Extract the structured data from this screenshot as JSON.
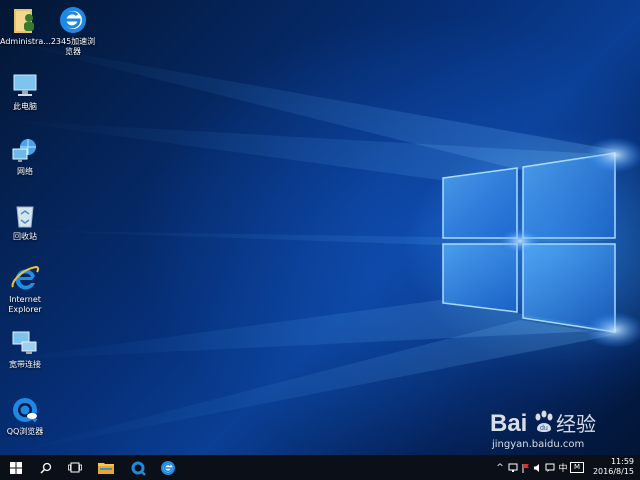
{
  "desktop": {
    "icons": [
      {
        "label": "Administra..."
      },
      {
        "label": "2345加速浏\n览器"
      },
      {
        "label": "此电脑"
      },
      {
        "label": "网络"
      },
      {
        "label": "回收站"
      },
      {
        "label": "Internet\nExplorer"
      },
      {
        "label": "宽带连接"
      },
      {
        "label": "QQ浏览器"
      }
    ]
  },
  "taskbar": {
    "start_icon": "windows-logo",
    "search_icon": "search",
    "task_view_icon": "task-view",
    "pinned": [
      "file-explorer",
      "qq-browser",
      "2345-browser"
    ],
    "tray": {
      "chevron": "^",
      "ime_label": "中",
      "ime_mode": "M"
    },
    "clock": {
      "time": "11:59",
      "date": "2016/8/15"
    }
  },
  "watermark": {
    "brand": "Baidu经验",
    "url": "jingyan.baidu.com"
  },
  "colors": {
    "accent": "#1e90ff",
    "taskbar": "#0b0f17",
    "desktop": "#063080"
  }
}
